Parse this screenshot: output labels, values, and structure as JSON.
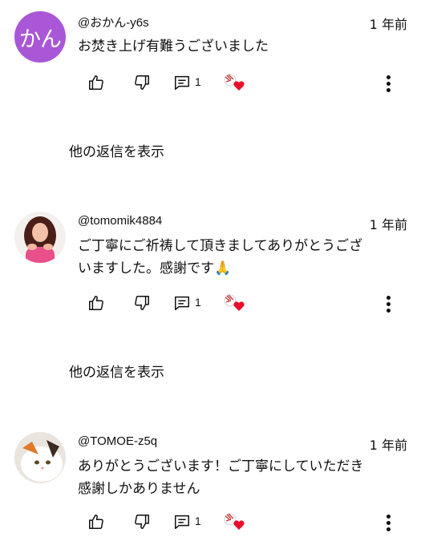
{
  "comments": [
    {
      "avatar_text": "かん",
      "avatar_color": "#a957d6",
      "handle": "@おかん-y6s",
      "time": "1 年前",
      "text_lines": [
        "お焚き上げ有難うございました"
      ],
      "reply_count": "1",
      "show_replies": "他の返信を表示"
    },
    {
      "avatar_text": "",
      "handle": "@tomomik4884",
      "time": "1 年前",
      "text_lines": [
        "ご丁寧にご祈祷して頂きましてありがとうござ",
        "いますした。感謝です🙏"
      ],
      "reply_count": "1",
      "show_replies": "他の返信を表示"
    },
    {
      "avatar_text": "",
      "handle": "@TOMOE-z5q",
      "time": "1 年前",
      "text_lines": [
        "ありがとうございます！ご丁寧にしていただき",
        "感謝しかありません"
      ],
      "reply_count": "1"
    }
  ],
  "icons": {
    "like": "thumbs-up-icon",
    "dislike": "thumbs-down-icon",
    "reply": "comment-icon",
    "creator_heart": "creator-heart-icon",
    "more": "more-vert-icon"
  },
  "colors": {
    "heart": "#e8112d",
    "avatar_purple": "#a957d6"
  }
}
